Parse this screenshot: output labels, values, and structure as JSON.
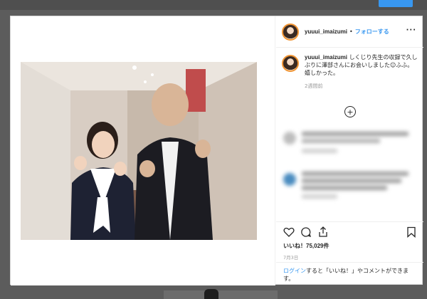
{
  "post": {
    "username": "yuuui_imaizumi",
    "separator": "•",
    "follow_label": "フォローする",
    "more_icon": "more-horizontal-icon"
  },
  "caption": {
    "username": "yuuui_imaizumi",
    "text": "しくじり先生の収録で久しぶりに澤部さんにお会いしました☺ふふ。嬉しかった。",
    "time_ago": "2週間前"
  },
  "load_more_icon": "plus-circle-icon",
  "actions": {
    "icons": [
      "heart-icon",
      "comment-icon",
      "share-icon",
      "bookmark-icon"
    ],
    "likes": "いいね！75,029件",
    "date": "7月3日"
  },
  "login_prompt": {
    "link": "ログイン",
    "rest": "すると「いいね！」やコメントができます。"
  },
  "colors": {
    "accent": "#3897f0",
    "background": "#5c5c5c",
    "text": "#262626",
    "muted": "#999999"
  }
}
